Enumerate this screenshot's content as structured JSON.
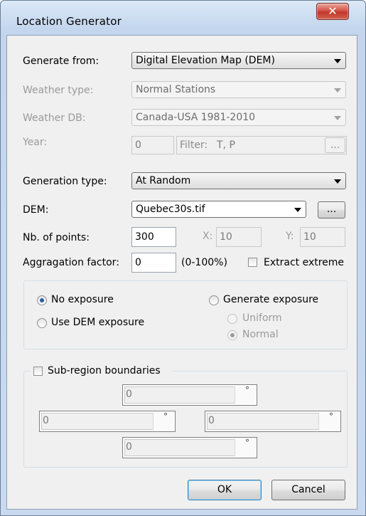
{
  "window": {
    "title": "Location Generator",
    "close_glyph": "✕"
  },
  "generate_from": {
    "label": "Generate from:",
    "value": "Digital Elevation Map (DEM)"
  },
  "weather_type": {
    "label": "Weather type:",
    "value": "Normal Stations"
  },
  "weather_db": {
    "label": "Weather DB:",
    "value": "Canada-USA 1981-2010"
  },
  "year": {
    "label": "Year:",
    "value": "0",
    "filter_label": "Filter:",
    "filter_value": "T, P",
    "browse_label": "..."
  },
  "generation_type": {
    "label": "Generation type:",
    "value": "At Random"
  },
  "dem": {
    "label": "DEM:",
    "value": "Quebec30s.tif",
    "browse_label": "..."
  },
  "nb_points": {
    "label": "Nb. of points:",
    "value": "300",
    "x_label": "X:",
    "x_value": "10",
    "y_label": "Y:",
    "y_value": "10"
  },
  "aggregation": {
    "label": "Aggragation factor:",
    "value": "0",
    "range": "(0-100%)",
    "extract_label": "Extract extreme"
  },
  "exposure": {
    "no_exposure": "No exposure",
    "use_dem_exposure": "Use DEM exposure",
    "generate_exposure": "Generate exposure",
    "uniform": "Uniform",
    "normal": "Normal"
  },
  "subregion": {
    "label": "Sub-region boundaries",
    "top": "0",
    "left": "0",
    "right": "0",
    "bottom": "0",
    "unit": "°"
  },
  "buttons": {
    "ok": "OK",
    "cancel": "Cancel"
  }
}
